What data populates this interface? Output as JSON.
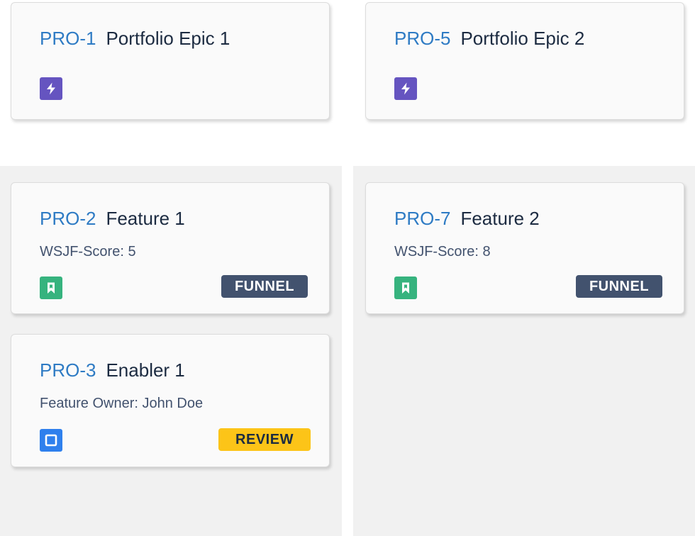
{
  "board": {
    "cards": [
      {
        "key": "PRO-1",
        "title": "Portfolio Epic 1",
        "type_icon": "epic-lightning-icon",
        "icon_color": "#6554c0"
      },
      {
        "key": "PRO-5",
        "title": "Portfolio Epic 2",
        "type_icon": "epic-lightning-icon",
        "icon_color": "#6554c0"
      },
      {
        "key": "PRO-2",
        "title": "Feature 1",
        "field": "WSJF-Score: 5",
        "type_icon": "story-bookmark-icon",
        "icon_color": "#36b37e",
        "status": "FUNNEL",
        "status_color": "#42526e"
      },
      {
        "key": "PRO-7",
        "title": "Feature 2",
        "field": "WSJF-Score: 8",
        "type_icon": "story-bookmark-icon",
        "icon_color": "#36b37e",
        "status": "FUNNEL",
        "status_color": "#42526e"
      },
      {
        "key": "PRO-3",
        "title": "Enabler 1",
        "field": "Feature Owner: John Doe",
        "type_icon": "task-square-icon",
        "icon_color": "#2f80ed",
        "status": "REVIEW",
        "status_color": "#fcc418"
      }
    ]
  }
}
